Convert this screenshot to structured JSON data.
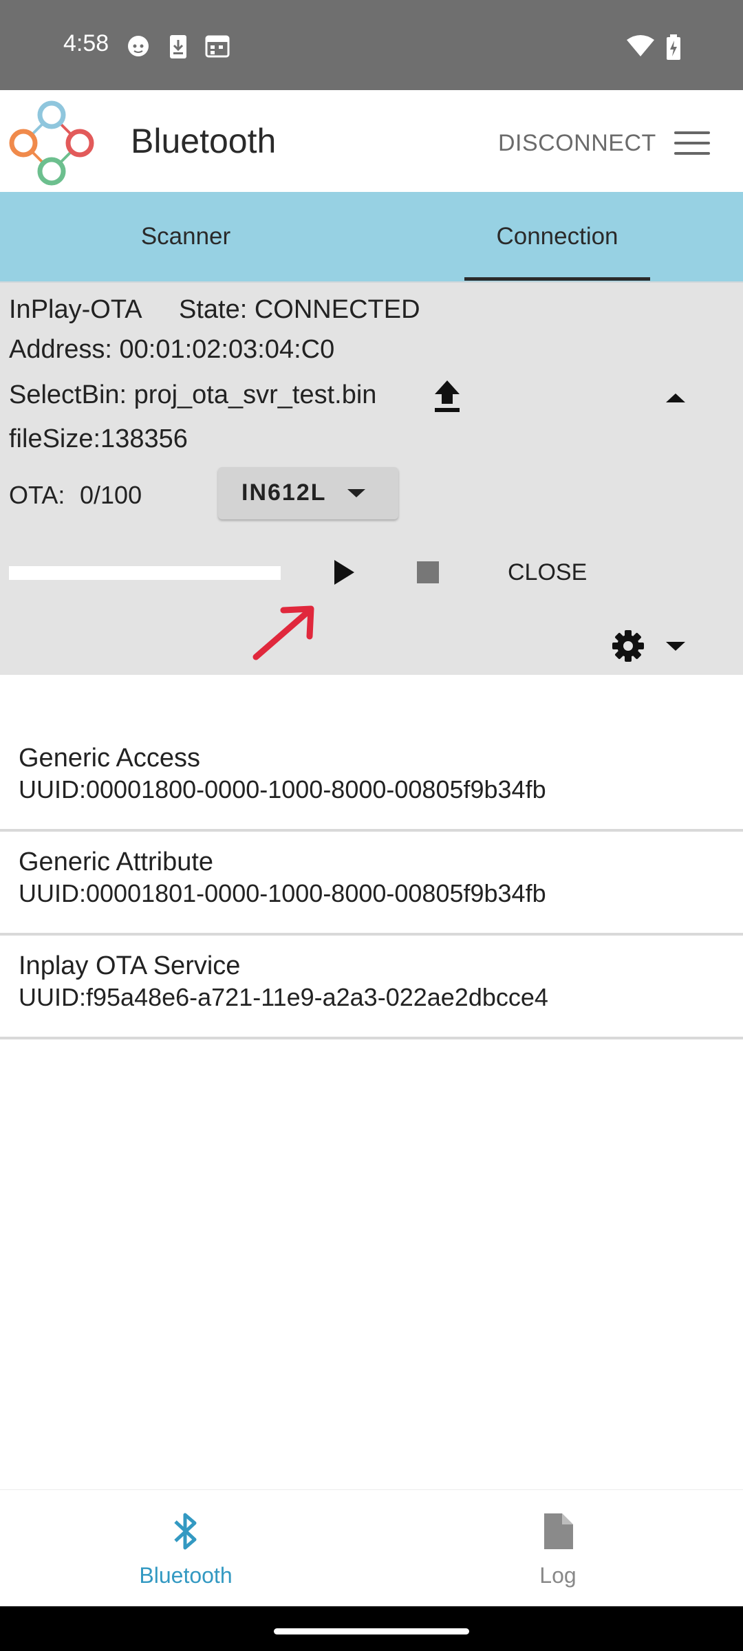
{
  "status_bar": {
    "time": "4:58"
  },
  "app_bar": {
    "title": "Bluetooth",
    "disconnect_label": "DISCONNECT"
  },
  "tabs": [
    {
      "label": "Scanner",
      "selected": false
    },
    {
      "label": "Connection",
      "selected": true
    }
  ],
  "device": {
    "name": "InPlay-OTA",
    "state_label": "State: CONNECTED",
    "address_label": "Address: 00:01:02:03:04:C0",
    "selectbin_label": "SelectBin: proj_ota_svr_test.bin",
    "filesize_label": "fileSize:138356",
    "ota_label": "OTA:",
    "ota_progress": "0/100",
    "chip": "IN612L",
    "progress_fraction": 0.0,
    "close_label": "CLOSE"
  },
  "services": [
    {
      "name": "Generic Access",
      "uuid": "UUID:00001800-0000-1000-8000-00805f9b34fb"
    },
    {
      "name": "Generic Attribute",
      "uuid": "UUID:00001801-0000-1000-8000-00805f9b34fb"
    },
    {
      "name": "Inplay OTA Service",
      "uuid": "UUID:f95a48e6-a721-11e9-a2a3-022ae2dbcce4"
    }
  ],
  "bottom_nav": [
    {
      "label": "Bluetooth",
      "icon": "bluetooth-icon",
      "active": true
    },
    {
      "label": "Log",
      "icon": "document-icon",
      "active": false
    }
  ],
  "colors": {
    "accent": "#3399c2",
    "tab_bg": "#97d1e3",
    "panel_bg": "#e3e3e3",
    "annotation_arrow": "#e0283c"
  }
}
